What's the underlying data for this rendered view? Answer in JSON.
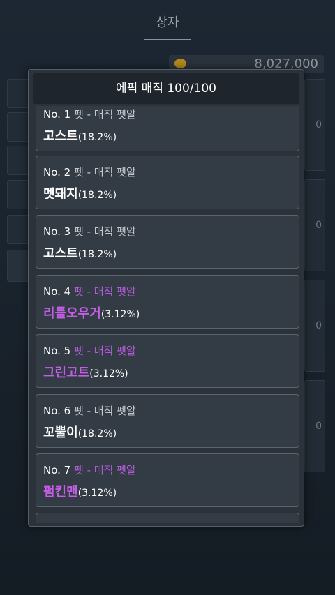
{
  "background": {
    "title": "상자",
    "currency_amount": "8,027,000",
    "right_edge_digit": "0"
  },
  "dialog": {
    "title": "에픽 매직  100/100",
    "items": [
      {
        "no": "No. 1",
        "sub": "펫 - 매직 펫알",
        "name": "고스트",
        "pct": "(18.2%)",
        "rarity": "normal"
      },
      {
        "no": "No. 2",
        "sub": "펫 - 매직 펫알",
        "name": "멧돼지",
        "pct": "(18.2%)",
        "rarity": "normal"
      },
      {
        "no": "No. 3",
        "sub": "펫 - 매직 펫알",
        "name": "고스트",
        "pct": "(18.2%)",
        "rarity": "normal"
      },
      {
        "no": "No. 4",
        "sub": "펫 - 매직 펫알",
        "name": "리틀오우거",
        "pct": "(3.12%)",
        "rarity": "epic"
      },
      {
        "no": "No. 5",
        "sub": "펫 - 매직 펫알",
        "name": "그린고트",
        "pct": "(3.12%)",
        "rarity": "epic"
      },
      {
        "no": "No. 6",
        "sub": "펫 - 매직 펫알",
        "name": "꼬뿔이",
        "pct": "(18.2%)",
        "rarity": "normal"
      },
      {
        "no": "No. 7",
        "sub": "펫 - 매직 펫알",
        "name": "펌킨맨",
        "pct": "(3.12%)",
        "rarity": "epic"
      }
    ]
  },
  "colors": {
    "epic": "#c45ee6",
    "normal": "#ffffff",
    "panel": "#2b323a",
    "item": "#333b44"
  }
}
